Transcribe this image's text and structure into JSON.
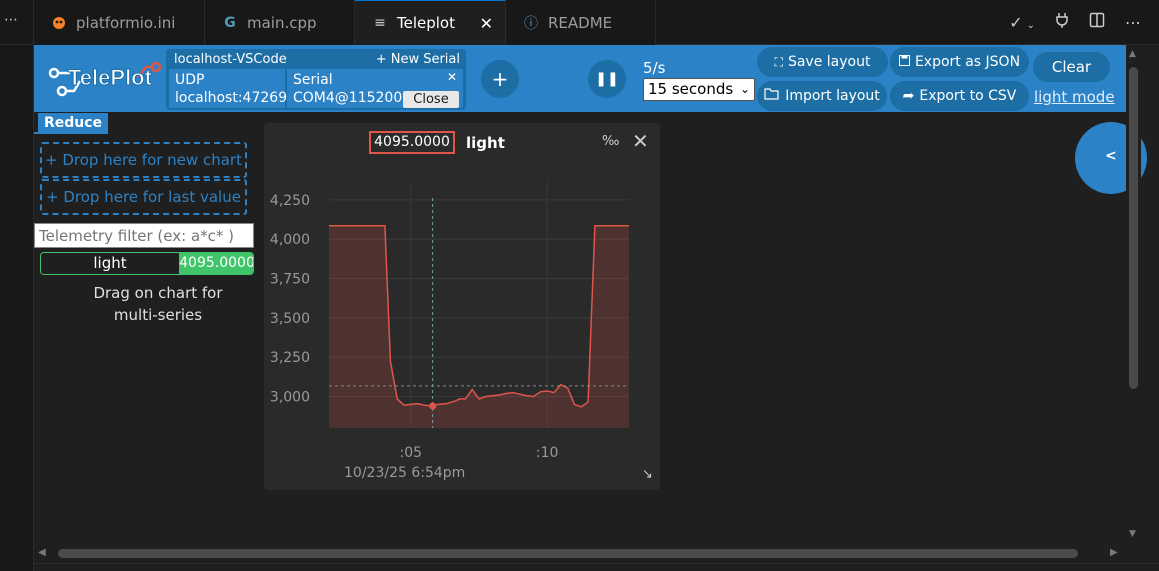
{
  "tabs": [
    {
      "label": "platformio.ini",
      "icon": "platformio-alien-icon",
      "color": "#f5822a"
    },
    {
      "label": "main.cpp",
      "icon": "cpp-file-icon",
      "color": "#519aba"
    },
    {
      "label": "Teleplot",
      "icon": "preview-lines-icon",
      "active": true
    },
    {
      "label": "README",
      "icon": "info-circle-icon",
      "color": "#519aba"
    }
  ],
  "tab_actions": [
    "check-icon",
    "chevron-down-icon",
    "plug-icon",
    "split-editor-icon",
    "more-actions-icon"
  ],
  "header": {
    "logo_text": "TelePlot",
    "connection_title": "localhost-VSCode",
    "new_serial": "+ New Serial",
    "udp_label": "UDP",
    "udp_address": "localhost:47269",
    "serial_label": "Serial",
    "serial_port": "COM4@115200",
    "close_label": "Close",
    "serial_remove": "✕",
    "add_connection": "+",
    "pause": "❚❚",
    "rate": "5/s",
    "duration": "15 seconds",
    "save_layout": "Save layout",
    "import_layout": "Import layout",
    "export_json": "Export as JSON",
    "export_csv": "Export to CSV",
    "clear": "Clear",
    "light_mode": "light mode"
  },
  "left_panel": {
    "reduce_label": "Reduce",
    "drop_new_chart": "+ Drop here for new chart",
    "drop_last_value": "+ Drop here for last value",
    "filter_placeholder": "Telemetry filter (ex: a*c* )",
    "telemetry": [
      {
        "name": "light",
        "value": "4095.0000"
      }
    ],
    "drag_hint_line1": "Drag on chart for",
    "drag_hint_line2": "multi-series"
  },
  "chart": {
    "current_value": "4095.0000",
    "series_name": "light",
    "permille": "‰",
    "close": "✕",
    "date_label": "10/23/25 6:54pm",
    "resize": "↘"
  },
  "side_toggle": "<",
  "colors": {
    "accent": "#2c82c6",
    "accent_dark": "#1c6ea4",
    "series": "#e0554a",
    "value_green": "#3fc46a"
  },
  "chart_data": {
    "type": "line",
    "title": "",
    "xlabel": "",
    "ylabel": "",
    "ylim": [
      2800,
      4370
    ],
    "yticks": [
      3000,
      3250,
      3500,
      3750,
      4000,
      4250
    ],
    "ytick_labels": [
      "3,000",
      "3,250",
      "3,500",
      "3,750",
      "4,000",
      "4,250"
    ],
    "xlim": [
      2,
      13
    ],
    "xticks": [
      5,
      10
    ],
    "xtick_labels": [
      ":05",
      ":10"
    ],
    "cursor_x": 5.8,
    "cursor_y": 3068,
    "series": [
      {
        "name": "light",
        "x": [
          2.0,
          4.05,
          4.25,
          4.5,
          4.75,
          5.0,
          5.25,
          5.5,
          5.8,
          6.0,
          6.3,
          6.6,
          6.8,
          7.0,
          7.25,
          7.5,
          7.75,
          8.0,
          8.25,
          8.5,
          8.75,
          9.0,
          9.25,
          9.5,
          9.75,
          10.0,
          10.25,
          10.5,
          10.75,
          11.0,
          11.25,
          11.5,
          11.75,
          12.0,
          12.25,
          12.5,
          12.75,
          13.0
        ],
        "y": [
          4085,
          4085,
          3225,
          2985,
          2945,
          2950,
          2955,
          2945,
          2940,
          2950,
          2955,
          2970,
          2985,
          2985,
          3045,
          2985,
          3000,
          3005,
          3010,
          3020,
          3025,
          3015,
          3005,
          3000,
          3030,
          3035,
          3025,
          3075,
          3055,
          2950,
          2935,
          2965,
          4085,
          4085,
          4085,
          4085,
          4085,
          4085
        ]
      }
    ]
  }
}
